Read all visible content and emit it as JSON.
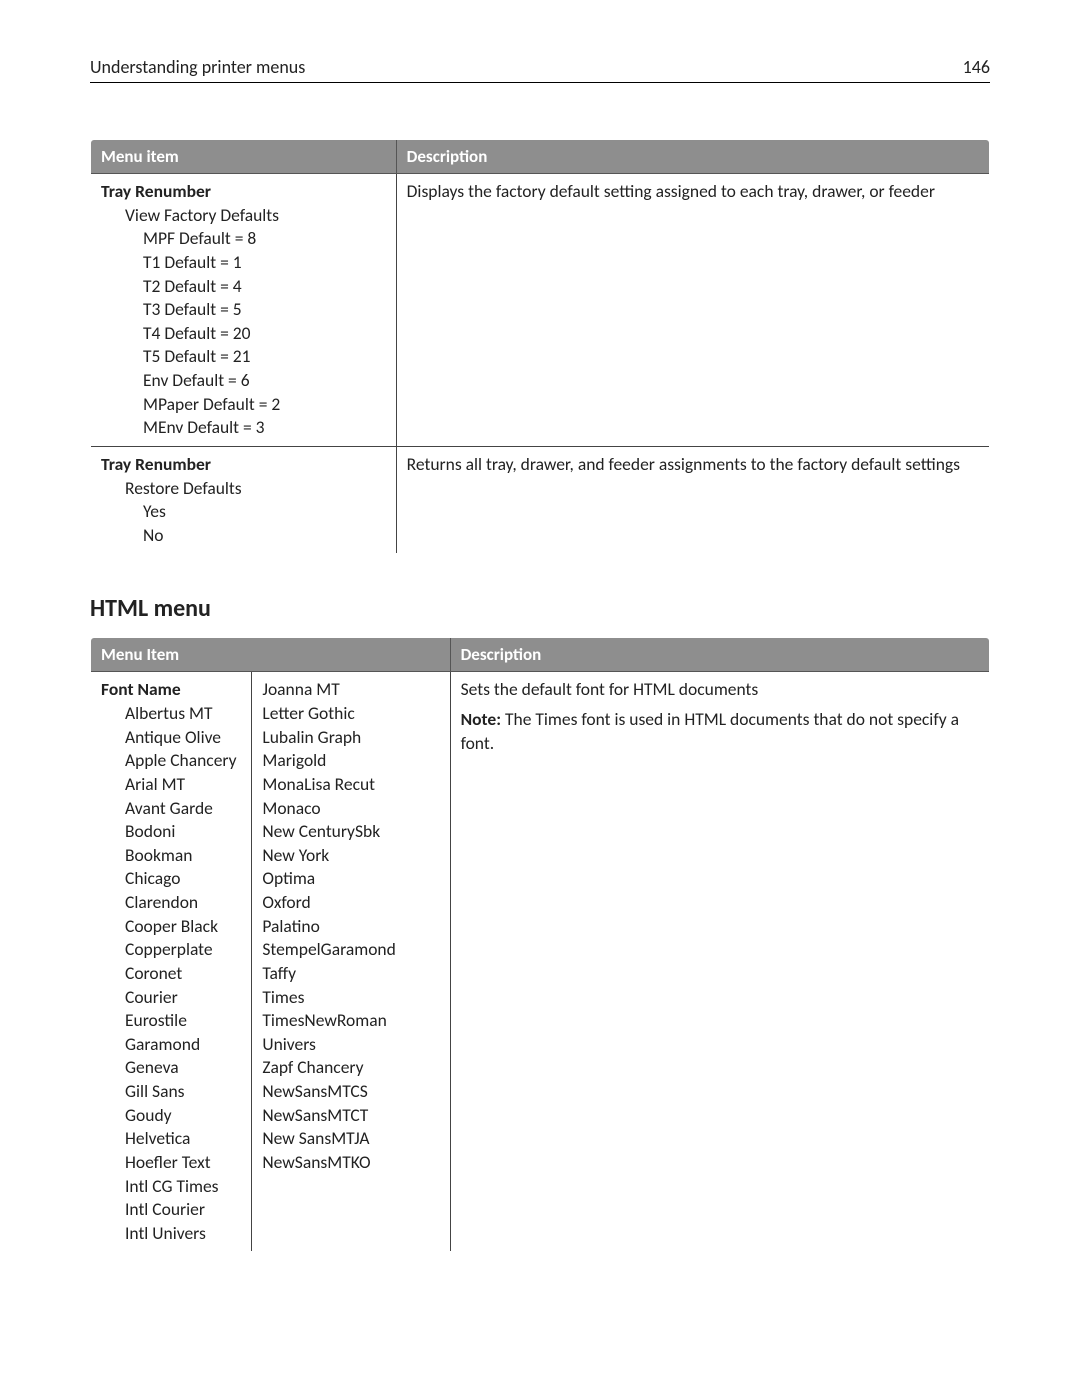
{
  "header": {
    "title": "Understanding printer menus",
    "page_number": "146"
  },
  "table1": {
    "headers": {
      "c1": "Menu item",
      "c2": "Description"
    },
    "rows": [
      {
        "title": "Tray Renumber",
        "sub1": "View Factory Defaults",
        "items": [
          "MPF Default = 8",
          "T1 Default = 1",
          "T2 Default = 4",
          "T3 Default = 5",
          "T4 Default = 20",
          "T5 Default = 21",
          "Env Default = 6",
          "MPaper Default = 2",
          "MEnv Default = 3"
        ],
        "description": "Displays the factory default setting assigned to each tray, drawer, or feeder"
      },
      {
        "title": "Tray Renumber",
        "sub1": "Restore Defaults",
        "items": [
          "Yes",
          "No"
        ],
        "description": "Returns all tray, drawer, and feeder assignments to the factory default settings"
      }
    ]
  },
  "section2_heading": "HTML menu",
  "table2": {
    "headers": {
      "c1": "Menu Item",
      "c2": "Description"
    },
    "row": {
      "title": "Font Name",
      "fonts_col1": [
        "Albertus MT",
        "Antique Olive",
        "Apple Chancery",
        "Arial MT",
        "Avant Garde",
        "Bodoni",
        "Bookman",
        "Chicago",
        "Clarendon",
        "Cooper Black",
        "Copperplate",
        "Coronet",
        "Courier",
        "Eurostile",
        "Garamond",
        "Geneva",
        "Gill Sans",
        "Goudy",
        "Helvetica",
        "Hoefler Text",
        "Intl CG Times",
        "Intl Courier",
        "Intl Univers"
      ],
      "fonts_col2": [
        "Joanna MT",
        "Letter Gothic",
        "Lubalin Graph",
        "Marigold",
        "MonaLisa Recut",
        "Monaco",
        "New CenturySbk",
        "New York",
        "Optima",
        "Oxford",
        "Palatino",
        "StempelGaramond",
        "Taffy",
        "Times",
        "TimesNewRoman",
        "Univers",
        "Zapf Chancery",
        "NewSansMTCS",
        "NewSansMTCT",
        "New SansMTJA",
        "NewSansMTKO"
      ],
      "desc_line1": "Sets the default font for HTML documents",
      "note_label": "Note:",
      "note_text": " The Times font is used in HTML documents that do not specify a font."
    }
  }
}
